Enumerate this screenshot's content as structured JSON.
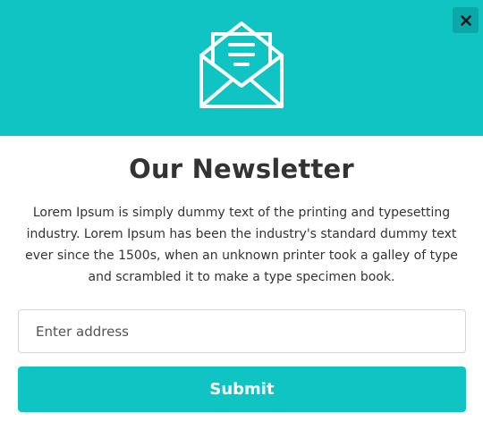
{
  "modal": {
    "close_icon": "close-icon",
    "header_icon": "envelope-letter-icon",
    "title": "Our Newsletter",
    "description": "Lorem Ipsum is simply dummy text of the printing and typesetting industry. Lorem Ipsum has been the industry's standard dummy text ever since the 1500s, when an unknown printer took a galley of type and scrambled it to make a type specimen book.",
    "email_placeholder": "Enter address",
    "email_value": "",
    "submit_label": "Submit"
  },
  "colors": {
    "accent": "#10c4c4",
    "close_button_bg": "#0aa8a8",
    "text": "#333333",
    "background": "#ffffff"
  }
}
